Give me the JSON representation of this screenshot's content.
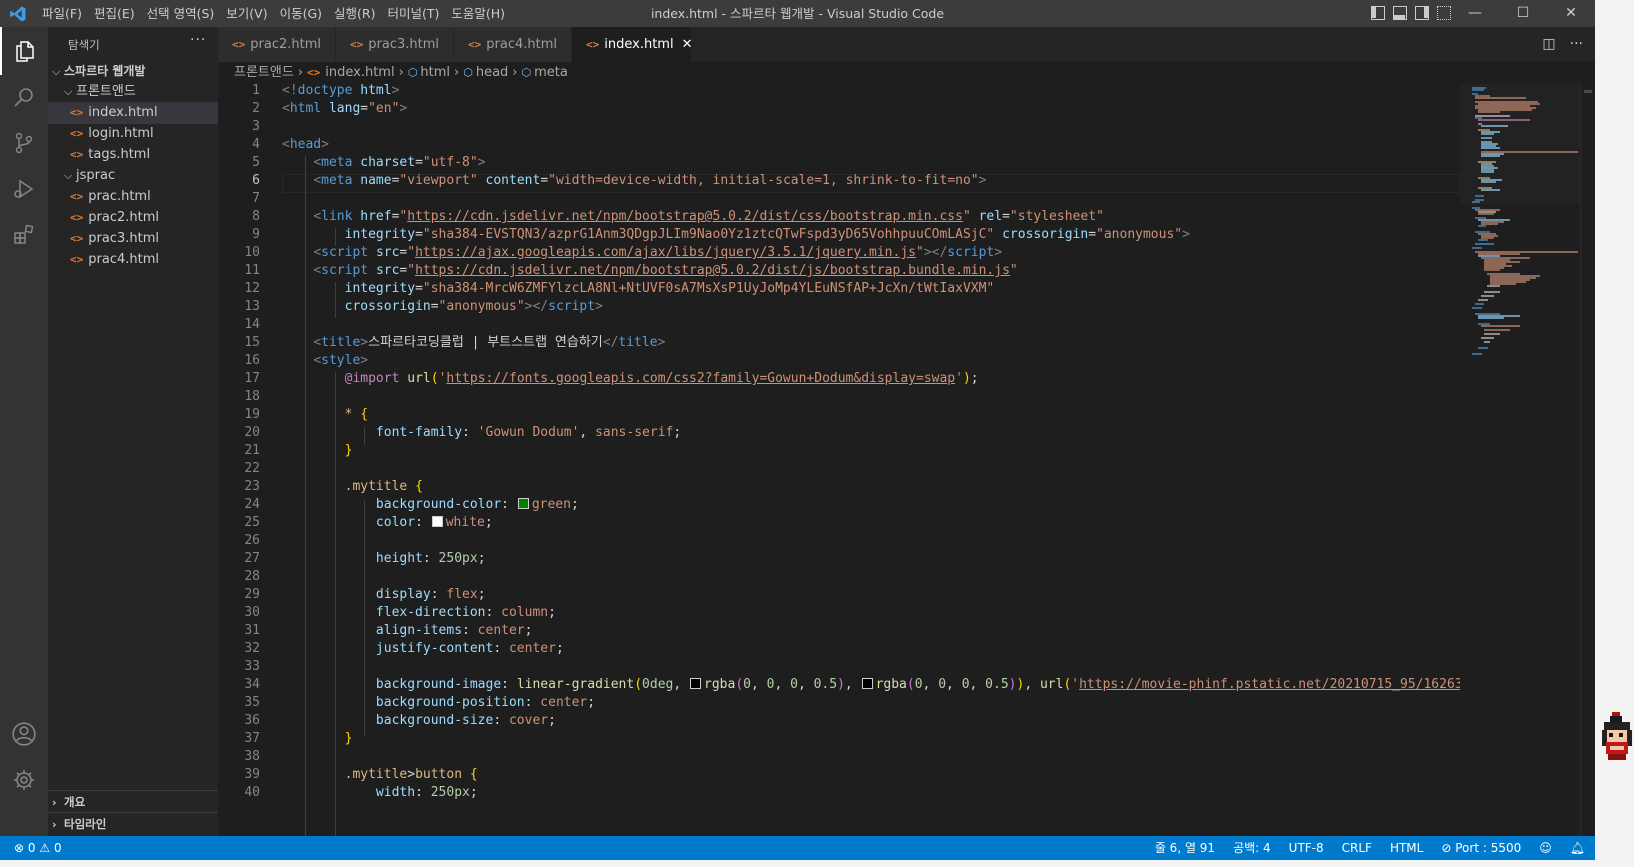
{
  "titlebar": {
    "menu": [
      "파일(F)",
      "편집(E)",
      "선택 영역(S)",
      "보기(V)",
      "이동(G)",
      "실행(R)",
      "터미널(T)",
      "도움말(H)"
    ],
    "title": "index.html - 스파르타 웹개발 - Visual Studio Code",
    "minimize": "—",
    "maximize": "☐",
    "close": "✕"
  },
  "sidebar": {
    "title": "탐색기",
    "more": "···",
    "root": "스파르타 웹개발",
    "folder1": "프론트앤드",
    "folder1_files": [
      "index.html",
      "login.html",
      "tags.html"
    ],
    "folder2": "jsprac",
    "folder2_files": [
      "prac.html",
      "prac2.html",
      "prac3.html",
      "prac4.html"
    ],
    "outline": "개요",
    "timeline": "타임라인"
  },
  "tabs": [
    "prac2.html",
    "prac3.html",
    "prac4.html",
    "index.html"
  ],
  "file_icon": "<>",
  "breadcrumb": [
    "프론트앤드",
    "index.html",
    "html",
    "head",
    "meta"
  ],
  "editor": {
    "line_numbers": [
      "1",
      "2",
      "3",
      "4",
      "5",
      "6",
      "7",
      "8",
      "9",
      "10",
      "11",
      "12",
      "13",
      "14",
      "15",
      "16",
      "17",
      "18",
      "19",
      "20",
      "21",
      "22",
      "23",
      "24",
      "25",
      "26",
      "27",
      "28",
      "29",
      "30",
      "31",
      "32",
      "33",
      "34",
      "35",
      "36",
      "37",
      "38",
      "39",
      "40"
    ],
    "current_line": "6"
  },
  "statusbar": {
    "errors": "0",
    "warnings": "0",
    "position": "줄 6, 열 91",
    "spaces": "공백: 4",
    "encoding": "UTF-8",
    "eol": "CRLF",
    "language": "HTML",
    "port": "Port : 5500"
  },
  "colors": {
    "statusbar": "#007acc",
    "editor_bg": "#1e1e1e",
    "sidebar_bg": "#252526",
    "activitybar_bg": "#333333",
    "swatch_green": "#008000",
    "swatch_white": "#ffffff",
    "swatch_black": "#000000"
  }
}
